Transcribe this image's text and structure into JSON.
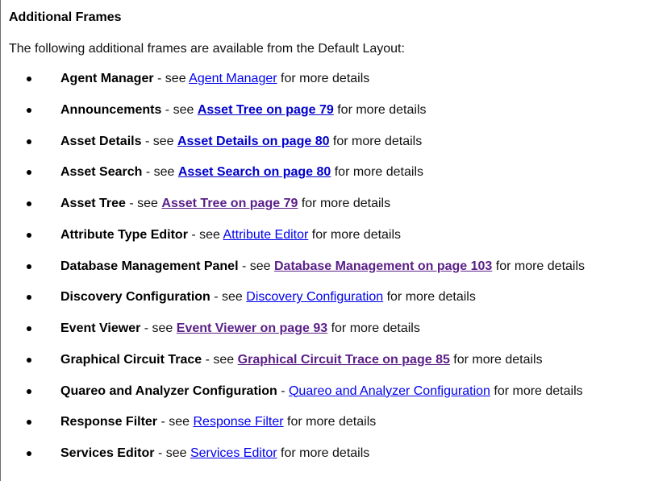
{
  "heading": "Additional Frames",
  "intro": "The following additional frames are available from the Default Layout:",
  "items": [
    {
      "name": "Agent Manager",
      "sep": " - see ",
      "link": "Agent Manager",
      "tail": " for more details"
    },
    {
      "name": "Announcements",
      "sep": " - see ",
      "link": "Asset Tree on page 79",
      "tail": " for more details"
    },
    {
      "name": "Asset Details",
      "sep": " - see ",
      "link": "Asset Details on page 80",
      "tail": " for more details"
    },
    {
      "name": "Asset Search",
      "sep": " - see ",
      "link": "Asset Search on page 80",
      "tail": " for more details"
    },
    {
      "name": "Asset Tree",
      "sep": " - see ",
      "link": "Asset Tree on page 79",
      "tail": " for more details"
    },
    {
      "name": "Attribute Type Editor",
      "sep": " - see ",
      "link": "Attribute Editor",
      "tail": " for more details"
    },
    {
      "name": "Database Management Panel",
      "sep": " - see ",
      "link": "Database Management on page 103",
      "tail": " for more details"
    },
    {
      "name": "Discovery Configuration",
      "sep": " - see ",
      "link": "Discovery Configuration",
      "tail": " for more details"
    },
    {
      "name": "Event Viewer",
      "sep": " - see ",
      "link": "Event Viewer on page 93",
      "tail": " for more details"
    },
    {
      "name": "Graphical Circuit Trace",
      "sep": " - see ",
      "link": "Graphical Circuit Trace on page 85",
      "tail": " for more details"
    },
    {
      "name": "Quareo and Analyzer Configuration",
      "sep": " - ",
      "link": "Quareo and Analyzer Configuration",
      "tail": " for more details"
    },
    {
      "name": "Response Filter",
      "sep": " - see ",
      "link": "Response Filter",
      "tail": " for more details"
    },
    {
      "name": "Services Editor",
      "sep": " - see ",
      "link": "Services Editor",
      "tail": " for more details"
    }
  ],
  "colors": {
    "link": "#0000ee",
    "link_bold": "#0000cc",
    "link_visited": "#5a1f87",
    "text": "#000000"
  }
}
